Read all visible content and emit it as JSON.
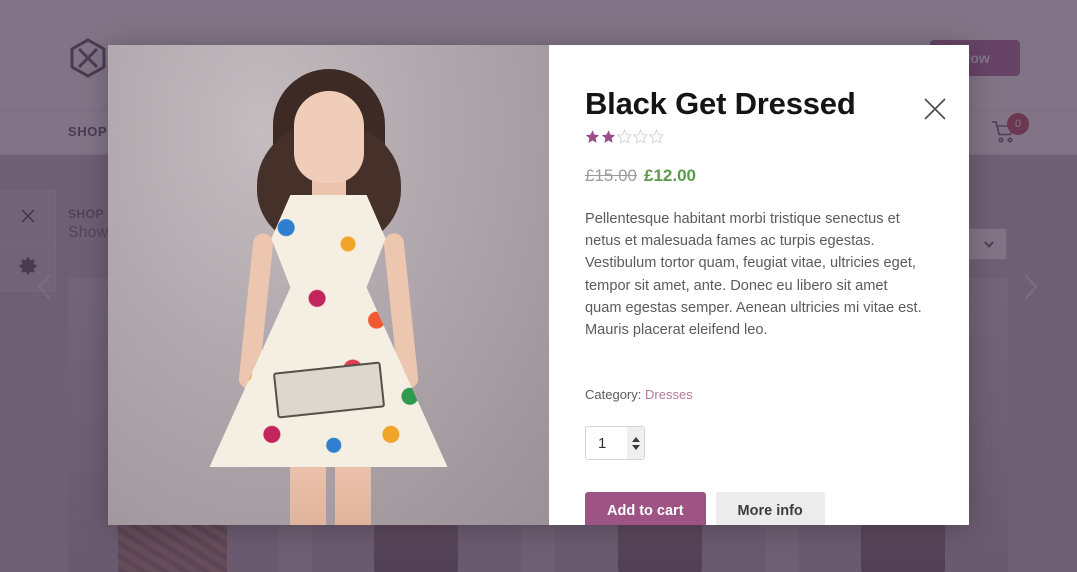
{
  "background": {
    "logo_icon": "brand-hexagon-x-logo",
    "nav": {
      "shop_label": "SHOP"
    },
    "buy_button_label": "Now",
    "cart_icon": "shopping-cart-icon",
    "cart_count": "0",
    "breadcrumb": "SHOP",
    "results_text": "Showing",
    "sort_select_value": "",
    "rail": [
      {
        "icon": "close-icon",
        "name": "rail-close"
      },
      {
        "icon": "gear-icon",
        "name": "rail-settings"
      }
    ],
    "carousel": {
      "prev_icon": "chevron-left-icon",
      "next_icon": "chevron-right-icon"
    },
    "products": [
      {
        "name": "product-card-1"
      },
      {
        "name": "product-card-2"
      },
      {
        "name": "product-card-3"
      },
      {
        "name": "product-card-4"
      }
    ]
  },
  "modal": {
    "close_icon": "close-icon",
    "image_alt": "model-wearing-floral-dress",
    "title": "Black Get Dressed",
    "rating": {
      "value": 2,
      "max": 5,
      "filled_color": "#9b4f88",
      "empty_color": "#cfcfcf"
    },
    "price_old": "£15.00",
    "price_new": "£12.00",
    "description": "Pellentesque habitant morbi tristique senectus et netus et malesuada fames ac turpis egestas. Vestibulum tortor quam, feugiat vitae, ultricies eget, tempor sit amet, ante. Donec eu libero sit amet quam egestas semper. Aenean ultricies mi vitae est. Mauris placerat eleifend leo.",
    "category_label": "Category:",
    "category_value": "Dresses",
    "quantity": "1",
    "add_to_cart_label": "Add to cart",
    "more_info_label": "More info"
  },
  "colors": {
    "accent_purple": "#9d5485",
    "price_green": "#5b9a4e",
    "category_link": "#b07b95",
    "overlay": "#513e58"
  }
}
